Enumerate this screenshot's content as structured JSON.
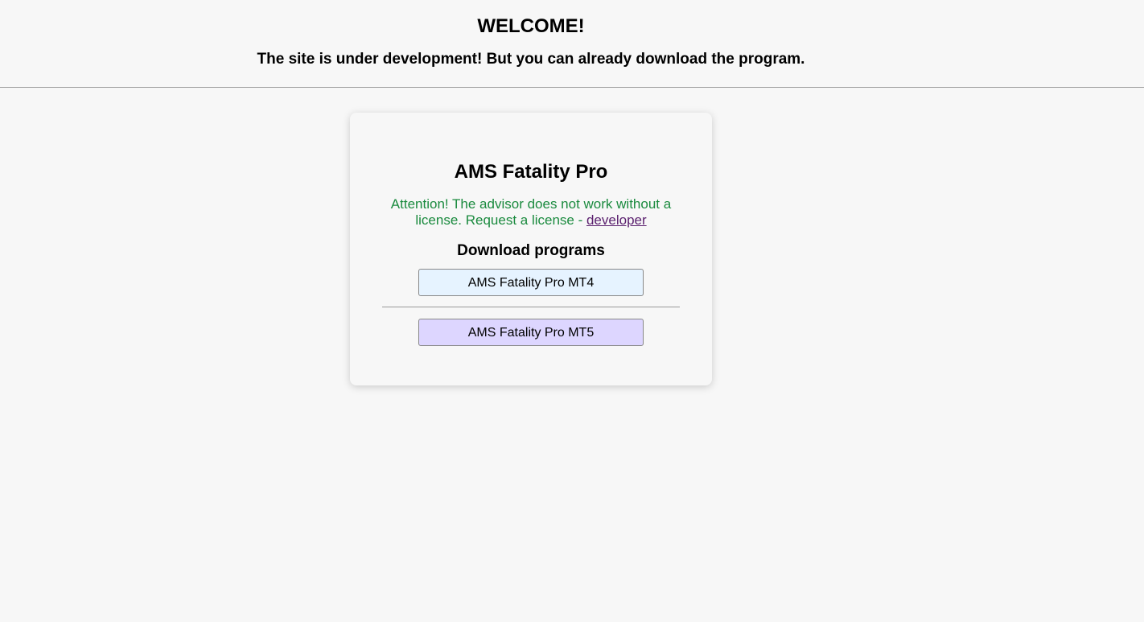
{
  "header": {
    "title": "WELCOME!",
    "subtitle": "The site is under development! But you can already download the program."
  },
  "card": {
    "title": "AMS Fatality Pro",
    "notice_text": "Attention! The advisor does not work without a license. Request a license - ",
    "notice_link": "developer",
    "downloads_heading": "Download programs",
    "buttons": [
      {
        "label": "AMS Fatality Pro MT4",
        "color": "#e6f3ff"
      },
      {
        "label": "AMS Fatality Pro MT5",
        "color": "#ddd6ff"
      }
    ]
  },
  "colors": {
    "background": "#f7f7f7",
    "notice_green": "#1a8a3e",
    "link": "#5a1f6e"
  }
}
